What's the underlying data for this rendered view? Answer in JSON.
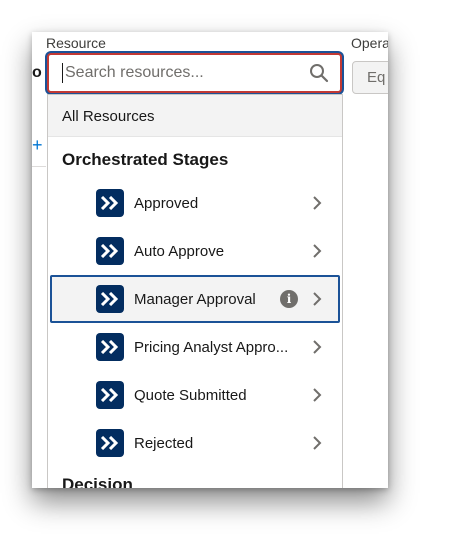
{
  "labels": {
    "resource": "Resource",
    "operator": "Opera"
  },
  "left_edge": {
    "text": "o",
    "plus": "+"
  },
  "search": {
    "placeholder": "Search resources...",
    "value": ""
  },
  "operator": {
    "value": "Eq"
  },
  "dropdown": {
    "all_resources": "All Resources",
    "groups": [
      {
        "heading": "Orchestrated Stages",
        "items": [
          {
            "label": "Approved",
            "icon": "chevron-right-double-icon",
            "selected": false,
            "info": false
          },
          {
            "label": "Auto Approve",
            "icon": "chevron-right-double-icon",
            "selected": false,
            "info": false
          },
          {
            "label": "Manager Approval",
            "icon": "chevron-right-double-icon",
            "selected": true,
            "info": true
          },
          {
            "label": "Pricing Analyst Appro...",
            "icon": "chevron-right-double-icon",
            "selected": false,
            "info": false
          },
          {
            "label": "Quote Submitted",
            "icon": "chevron-right-double-icon",
            "selected": false,
            "info": false
          },
          {
            "label": "Rejected",
            "icon": "chevron-right-double-icon",
            "selected": false,
            "info": false
          }
        ]
      },
      {
        "heading": "Decision",
        "items": []
      }
    ],
    "info_glyph": "i"
  },
  "colors": {
    "stage_icon_bg": "#032d60",
    "focus_ring": "#1b5297",
    "error_border": "#c23934",
    "selected_bg": "#f3f3f3"
  }
}
